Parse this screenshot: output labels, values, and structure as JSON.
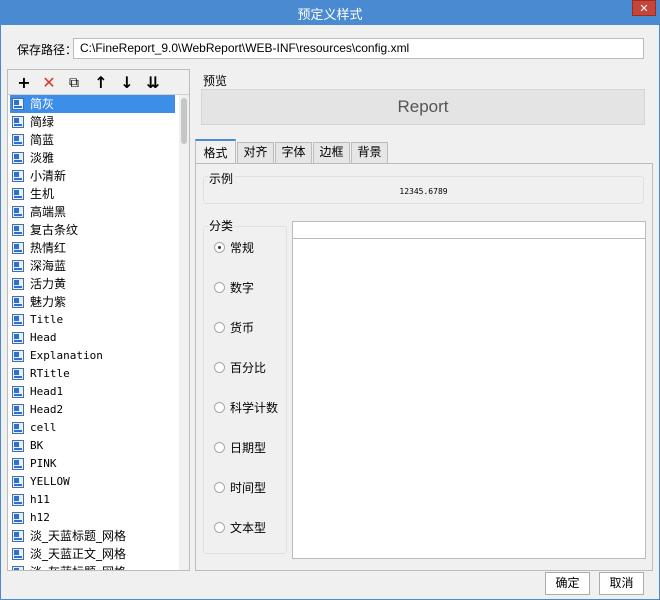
{
  "window": {
    "title": "预定义样式",
    "close_glyph": "✕"
  },
  "path": {
    "label": "保存路径：",
    "value": "C:\\FineReport_9.0\\WebReport\\WEB-INF\\resources\\config.xml"
  },
  "toolbar": {
    "add": "+",
    "delete": "✕",
    "copy": "⧉",
    "up": "↑",
    "down": "↓",
    "sort": "⇊"
  },
  "styles": [
    "简灰",
    "简绿",
    "简蓝",
    "淡雅",
    "小清新",
    "生机",
    "高端黑",
    "复古条纹",
    "热情红",
    "深海蓝",
    "活力黄",
    "魅力紫",
    "Title",
    "Head",
    "Explanation",
    "RTitle",
    "Head1",
    "Head2",
    "cell",
    "BK",
    "PINK",
    "YELLOW",
    "h11",
    "h12",
    "淡_天蓝标题_网格",
    "淡_天蓝正文_网格",
    "淡_灰蓝标题_网格"
  ],
  "preview": {
    "label": "预览",
    "text": "Report"
  },
  "tabs": [
    "格式",
    "对齐",
    "字体",
    "边框",
    "背景"
  ],
  "example": {
    "label": "示例",
    "value": "12345.6789"
  },
  "category": {
    "label": "分类",
    "options": [
      "常规",
      "数字",
      "货币",
      "百分比",
      "科学计数",
      "日期型",
      "时间型",
      "文本型"
    ],
    "selected_index": 0
  },
  "buttons": {
    "ok": "确定",
    "cancel": "取消"
  },
  "colors": {
    "titlebar": "#4a8ad0",
    "selection": "#3d8ee8",
    "close": "#c7443b"
  }
}
